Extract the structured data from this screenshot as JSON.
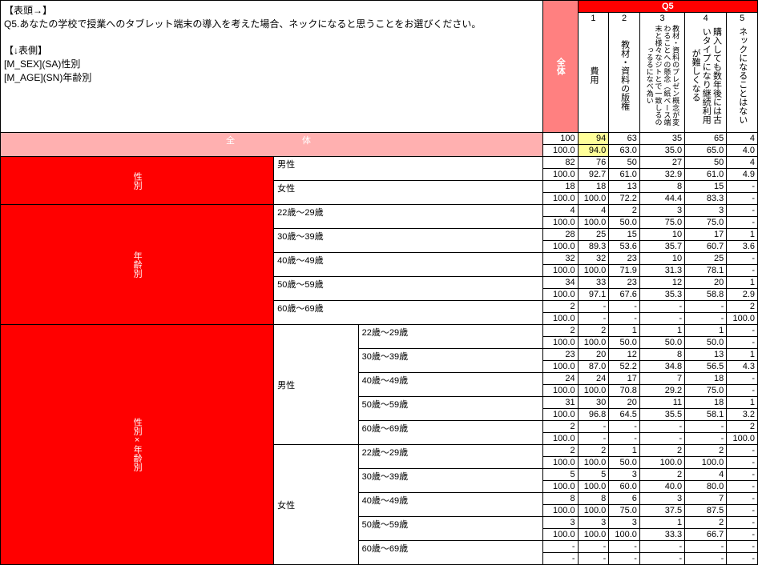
{
  "desc": "【表頭→】\nQ5.あなたの学校で授業へのタブレット端末の導入を考えた場合、ネックになると思うことをお選びください。\n\n【↓表側】\n[M_SEX](SA)性別\n[M_AGE](SN)年齢別",
  "header": {
    "zentai": "全体",
    "q5": "Q5",
    "cols": [
      {
        "n": "1",
        "label": "費用"
      },
      {
        "n": "2",
        "label": "教材・資料の版権"
      },
      {
        "n": "3",
        "label": "教材・資料のプレゼン概念が変わることへの懸念（紙ベース端末と様々なジトとで一致しるのっるるになべ為い"
      },
      {
        "n": "4",
        "label": "購入しても数年後には古いタイプになり継続利用が難しくなる"
      },
      {
        "n": "5",
        "label": "ネックになることはない"
      }
    ]
  },
  "sides": {
    "total": "全　　　　体",
    "sex": "性別",
    "age": "年齢別",
    "sexage": "性別×年齢別",
    "male": "男性",
    "female": "女性",
    "ages": [
      "22歳～29歳",
      "30歳～39歳",
      "40歳～49歳",
      "50歳～59歳",
      "60歳～69歳"
    ]
  },
  "rows": [
    {
      "r1": [
        "100",
        "94",
        "63",
        "35",
        "65",
        "4"
      ],
      "r2": [
        "100.0",
        "94.0",
        "63.0",
        "35.0",
        "65.0",
        "4.0"
      ]
    },
    {
      "r1": [
        "82",
        "76",
        "50",
        "27",
        "50",
        "4"
      ],
      "r2": [
        "100.0",
        "92.7",
        "61.0",
        "32.9",
        "61.0",
        "4.9"
      ]
    },
    {
      "r1": [
        "18",
        "18",
        "13",
        "8",
        "15",
        "-"
      ],
      "r2": [
        "100.0",
        "100.0",
        "72.2",
        "44.4",
        "83.3",
        "-"
      ]
    },
    {
      "r1": [
        "4",
        "4",
        "2",
        "3",
        "3",
        "-"
      ],
      "r2": [
        "100.0",
        "100.0",
        "50.0",
        "75.0",
        "75.0",
        "-"
      ]
    },
    {
      "r1": [
        "28",
        "25",
        "15",
        "10",
        "17",
        "1"
      ],
      "r2": [
        "100.0",
        "89.3",
        "53.6",
        "35.7",
        "60.7",
        "3.6"
      ]
    },
    {
      "r1": [
        "32",
        "32",
        "23",
        "10",
        "25",
        "-"
      ],
      "r2": [
        "100.0",
        "100.0",
        "71.9",
        "31.3",
        "78.1",
        "-"
      ]
    },
    {
      "r1": [
        "34",
        "33",
        "23",
        "12",
        "20",
        "1"
      ],
      "r2": [
        "100.0",
        "97.1",
        "67.6",
        "35.3",
        "58.8",
        "2.9"
      ]
    },
    {
      "r1": [
        "2",
        "-",
        "-",
        "-",
        "-",
        "2"
      ],
      "r2": [
        "100.0",
        "-",
        "-",
        "-",
        "-",
        "100.0"
      ]
    },
    {
      "r1": [
        "2",
        "2",
        "1",
        "1",
        "1",
        "-"
      ],
      "r2": [
        "100.0",
        "100.0",
        "50.0",
        "50.0",
        "50.0",
        "-"
      ]
    },
    {
      "r1": [
        "23",
        "20",
        "12",
        "8",
        "13",
        "1"
      ],
      "r2": [
        "100.0",
        "87.0",
        "52.2",
        "34.8",
        "56.5",
        "4.3"
      ]
    },
    {
      "r1": [
        "24",
        "24",
        "17",
        "7",
        "18",
        "-"
      ],
      "r2": [
        "100.0",
        "100.0",
        "70.8",
        "29.2",
        "75.0",
        "-"
      ]
    },
    {
      "r1": [
        "31",
        "30",
        "20",
        "11",
        "18",
        "1"
      ],
      "r2": [
        "100.0",
        "96.8",
        "64.5",
        "35.5",
        "58.1",
        "3.2"
      ]
    },
    {
      "r1": [
        "2",
        "-",
        "-",
        "-",
        "-",
        "2"
      ],
      "r2": [
        "100.0",
        "-",
        "-",
        "-",
        "-",
        "100.0"
      ]
    },
    {
      "r1": [
        "2",
        "2",
        "1",
        "2",
        "2",
        "-"
      ],
      "r2": [
        "100.0",
        "100.0",
        "50.0",
        "100.0",
        "100.0",
        "-"
      ]
    },
    {
      "r1": [
        "5",
        "5",
        "3",
        "2",
        "4",
        "-"
      ],
      "r2": [
        "100.0",
        "100.0",
        "60.0",
        "40.0",
        "80.0",
        "-"
      ]
    },
    {
      "r1": [
        "8",
        "8",
        "6",
        "3",
        "7",
        "-"
      ],
      "r2": [
        "100.0",
        "100.0",
        "75.0",
        "37.5",
        "87.5",
        "-"
      ]
    },
    {
      "r1": [
        "3",
        "3",
        "3",
        "1",
        "2",
        "-"
      ],
      "r2": [
        "100.0",
        "100.0",
        "100.0",
        "33.3",
        "66.7",
        "-"
      ]
    },
    {
      "r1": [
        "-",
        "-",
        "-",
        "-",
        "-",
        "-"
      ],
      "r2": [
        "-",
        "-",
        "-",
        "-",
        "-",
        "-"
      ]
    }
  ]
}
